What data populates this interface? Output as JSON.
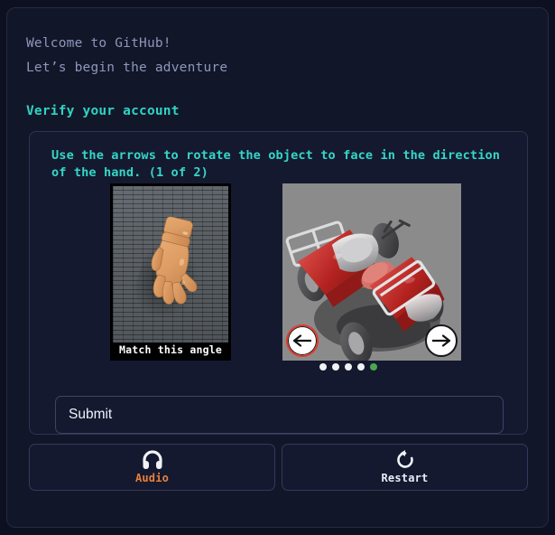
{
  "greeting": {
    "line1": "Welcome to GitHub!",
    "line2": "Let’s begin the adventure"
  },
  "verify_title": "Verify your account",
  "captcha": {
    "prompt": "Use the arrows to rotate the object to face in the direction of the hand. (1 of 2)",
    "step_label": "(1 of 2)",
    "hand_panel": {
      "caption": "Match this angle",
      "subject": "wooden-mannequin-hand",
      "direction": "down-right"
    },
    "object_panel": {
      "subject": "red-silver-atv-quad-bike",
      "background_color": "#8b8b8b",
      "left_arrow_label": "←",
      "right_arrow_label": "→",
      "left_arrow_icon": "arrow-left-icon",
      "right_arrow_icon": "arrow-right-icon",
      "left_arrow_highlight_color": "#e03a2f"
    },
    "progress": {
      "total": 5,
      "active_index": 4,
      "active_color": "#49a84e",
      "inactive_color": "#f2f2f2"
    }
  },
  "submit": {
    "label": "Submit"
  },
  "footer": {
    "audio": {
      "label": "Audio",
      "icon": "headphones-icon",
      "color": "#e8803a"
    },
    "restart": {
      "label": "Restart",
      "icon": "restart-icon",
      "color": "#e9edf7"
    }
  },
  "theme": {
    "page_background": "#0d1020",
    "panel_background": "#121629",
    "accent_teal": "#2fd4c4",
    "muted_text": "#8e97bb"
  }
}
